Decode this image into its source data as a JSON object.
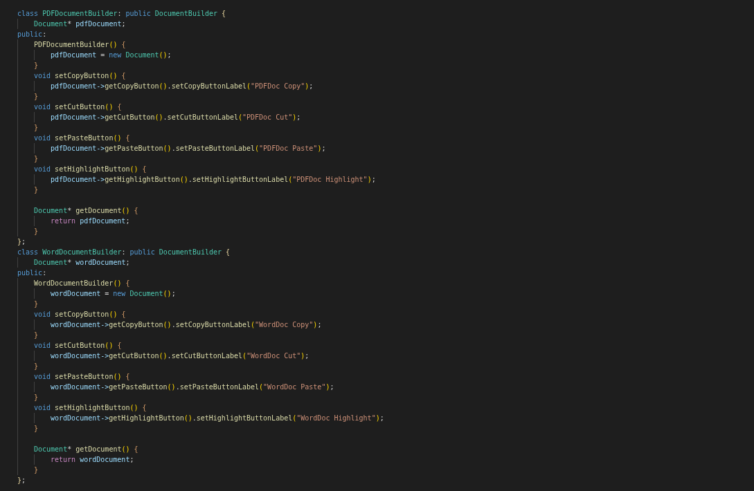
{
  "editor": {
    "lines": [
      {
        "tokens": [
          {
            "kind": "kw",
            "text": "class "
          },
          {
            "kind": "type",
            "text": "PDFDocumentBuilder"
          },
          {
            "kind": "punc",
            "text": ": "
          },
          {
            "kind": "kw",
            "text": "public "
          },
          {
            "kind": "type",
            "text": "DocumentBuilder "
          },
          {
            "kind": "brace",
            "text": "{"
          }
        ],
        "children": [
          {
            "tokens": [
              {
                "kind": "type",
                "text": "Document"
              },
              {
                "kind": "punc",
                "text": "* "
              },
              {
                "kind": "var",
                "text": "pdfDocument"
              },
              {
                "kind": "punc",
                "text": ";"
              }
            ]
          }
        ]
      },
      {
        "tokens": [
          {
            "kind": "kw",
            "text": "public"
          },
          {
            "kind": "punc",
            "text": ":"
          }
        ],
        "groups": [
          [
            {
              "tokens": [
                {
                  "kind": "fn",
                  "text": "PDFDocumentBuilder"
                },
                {
                  "kind": "paren",
                  "text": "()"
                },
                {
                  "kind": "brace2",
                  "text": " {"
                }
              ],
              "children": [
                {
                  "tokens": [
                    {
                      "kind": "var",
                      "text": "pdfDocument"
                    },
                    {
                      "kind": "punc",
                      "text": " = "
                    },
                    {
                      "kind": "kw",
                      "text": "new "
                    },
                    {
                      "kind": "type",
                      "text": "Document"
                    },
                    {
                      "kind": "paren",
                      "text": "()"
                    },
                    {
                      "kind": "punc",
                      "text": ";"
                    }
                  ]
                }
              ]
            },
            {
              "tokens": [
                {
                  "kind": "brace2",
                  "text": "}"
                }
              ]
            },
            {
              "tokens": [
                {
                  "kind": "kw",
                  "text": "void "
                },
                {
                  "kind": "fn",
                  "text": "setCopyButton"
                },
                {
                  "kind": "paren",
                  "text": "()"
                },
                {
                  "kind": "brace2",
                  "text": " {"
                }
              ],
              "children": [
                {
                  "tokens": [
                    {
                      "kind": "var",
                      "text": "pdfDocument->"
                    },
                    {
                      "kind": "fn",
                      "text": "getCopyButton"
                    },
                    {
                      "kind": "paren",
                      "text": "()"
                    },
                    {
                      "kind": "punc",
                      "text": "."
                    },
                    {
                      "kind": "fn",
                      "text": "setCopyButtonLabel"
                    },
                    {
                      "kind": "paren",
                      "text": "("
                    },
                    {
                      "kind": "str",
                      "text": "\"PDFDoc Copy\""
                    },
                    {
                      "kind": "paren",
                      "text": ")"
                    },
                    {
                      "kind": "punc",
                      "text": ";"
                    }
                  ]
                }
              ]
            },
            {
              "tokens": [
                {
                  "kind": "brace2",
                  "text": "}"
                }
              ]
            },
            {
              "tokens": [
                {
                  "kind": "kw",
                  "text": "void "
                },
                {
                  "kind": "fn",
                  "text": "setCutButton"
                },
                {
                  "kind": "paren",
                  "text": "()"
                },
                {
                  "kind": "brace2",
                  "text": " {"
                }
              ],
              "children": [
                {
                  "tokens": [
                    {
                      "kind": "var",
                      "text": "pdfDocument->"
                    },
                    {
                      "kind": "fn",
                      "text": "getCutButton"
                    },
                    {
                      "kind": "paren",
                      "text": "()"
                    },
                    {
                      "kind": "punc",
                      "text": "."
                    },
                    {
                      "kind": "fn",
                      "text": "setCutButtonLabel"
                    },
                    {
                      "kind": "paren",
                      "text": "("
                    },
                    {
                      "kind": "str",
                      "text": "\"PDFDoc Cut\""
                    },
                    {
                      "kind": "paren",
                      "text": ")"
                    },
                    {
                      "kind": "punc",
                      "text": ";"
                    }
                  ]
                }
              ]
            },
            {
              "tokens": [
                {
                  "kind": "brace2",
                  "text": "}"
                }
              ]
            },
            {
              "tokens": [
                {
                  "kind": "kw",
                  "text": "void "
                },
                {
                  "kind": "fn",
                  "text": "setPasteButton"
                },
                {
                  "kind": "paren",
                  "text": "()"
                },
                {
                  "kind": "brace2",
                  "text": " {"
                }
              ],
              "children": [
                {
                  "tokens": [
                    {
                      "kind": "var",
                      "text": "pdfDocument->"
                    },
                    {
                      "kind": "fn",
                      "text": "getPasteButton"
                    },
                    {
                      "kind": "paren",
                      "text": "()"
                    },
                    {
                      "kind": "punc",
                      "text": "."
                    },
                    {
                      "kind": "fn",
                      "text": "setPasteButtonLabel"
                    },
                    {
                      "kind": "paren",
                      "text": "("
                    },
                    {
                      "kind": "str",
                      "text": "\"PDFDoc Paste\""
                    },
                    {
                      "kind": "paren",
                      "text": ")"
                    },
                    {
                      "kind": "punc",
                      "text": ";"
                    }
                  ]
                }
              ]
            },
            {
              "tokens": [
                {
                  "kind": "brace2",
                  "text": "}"
                }
              ]
            },
            {
              "tokens": [
                {
                  "kind": "kw",
                  "text": "void "
                },
                {
                  "kind": "fn",
                  "text": "setHighlightButton"
                },
                {
                  "kind": "paren",
                  "text": "()"
                },
                {
                  "kind": "brace2",
                  "text": " {"
                }
              ],
              "children": [
                {
                  "tokens": [
                    {
                      "kind": "var",
                      "text": "pdfDocument->"
                    },
                    {
                      "kind": "fn",
                      "text": "getHighlightButton"
                    },
                    {
                      "kind": "paren",
                      "text": "()"
                    },
                    {
                      "kind": "punc",
                      "text": "."
                    },
                    {
                      "kind": "fn",
                      "text": "setHighlightButtonLabel"
                    },
                    {
                      "kind": "paren",
                      "text": "("
                    },
                    {
                      "kind": "str",
                      "text": "\"PDFDoc Highlight\""
                    },
                    {
                      "kind": "paren",
                      "text": ")"
                    },
                    {
                      "kind": "punc",
                      "text": ";"
                    }
                  ]
                }
              ]
            },
            {
              "tokens": [
                {
                  "kind": "brace2",
                  "text": "}"
                }
              ]
            }
          ],
          [
            {
              "tokens": [
                {
                  "kind": "type",
                  "text": "Document"
                },
                {
                  "kind": "punc",
                  "text": "* "
                },
                {
                  "kind": "fn",
                  "text": "getDocument"
                },
                {
                  "kind": "paren",
                  "text": "()"
                },
                {
                  "kind": "brace2",
                  "text": " {"
                }
              ],
              "children": [
                {
                  "tokens": [
                    {
                      "kind": "ctrl",
                      "text": "return "
                    },
                    {
                      "kind": "var",
                      "text": "pdfDocument"
                    },
                    {
                      "kind": "punc",
                      "text": ";"
                    }
                  ]
                }
              ]
            },
            {
              "tokens": [
                {
                  "kind": "brace2",
                  "text": "}"
                }
              ]
            }
          ]
        ]
      },
      {
        "tokens": [
          {
            "kind": "brace",
            "text": "}"
          },
          {
            "kind": "punc",
            "text": ";"
          }
        ]
      },
      {
        "tokens": [
          {
            "kind": "kw",
            "text": "class "
          },
          {
            "kind": "type",
            "text": "WordDocumentBuilder"
          },
          {
            "kind": "punc",
            "text": ": "
          },
          {
            "kind": "kw",
            "text": "public "
          },
          {
            "kind": "type",
            "text": "DocumentBuilder "
          },
          {
            "kind": "brace",
            "text": "{"
          }
        ],
        "children": [
          {
            "tokens": [
              {
                "kind": "type",
                "text": "Document"
              },
              {
                "kind": "punc",
                "text": "* "
              },
              {
                "kind": "var",
                "text": "wordDocument"
              },
              {
                "kind": "punc",
                "text": ";"
              }
            ]
          }
        ]
      },
      {
        "tokens": [
          {
            "kind": "kw",
            "text": "public"
          },
          {
            "kind": "punc",
            "text": ":"
          }
        ],
        "groups": [
          [
            {
              "tokens": [
                {
                  "kind": "fn",
                  "text": "WordDocumentBuilder"
                },
                {
                  "kind": "paren",
                  "text": "()"
                },
                {
                  "kind": "brace2",
                  "text": " {"
                }
              ],
              "children": [
                {
                  "tokens": [
                    {
                      "kind": "var",
                      "text": "wordDocument"
                    },
                    {
                      "kind": "punc",
                      "text": " = "
                    },
                    {
                      "kind": "kw",
                      "text": "new "
                    },
                    {
                      "kind": "type",
                      "text": "Document"
                    },
                    {
                      "kind": "paren",
                      "text": "()"
                    },
                    {
                      "kind": "punc",
                      "text": ";"
                    }
                  ]
                }
              ]
            },
            {
              "tokens": [
                {
                  "kind": "brace2",
                  "text": "}"
                }
              ]
            },
            {
              "tokens": [
                {
                  "kind": "kw",
                  "text": "void "
                },
                {
                  "kind": "fn",
                  "text": "setCopyButton"
                },
                {
                  "kind": "paren",
                  "text": "()"
                },
                {
                  "kind": "brace2",
                  "text": " {"
                }
              ],
              "children": [
                {
                  "tokens": [
                    {
                      "kind": "var",
                      "text": "wordDocument->"
                    },
                    {
                      "kind": "fn",
                      "text": "getCopyButton"
                    },
                    {
                      "kind": "paren",
                      "text": "()"
                    },
                    {
                      "kind": "punc",
                      "text": "."
                    },
                    {
                      "kind": "fn",
                      "text": "setCopyButtonLabel"
                    },
                    {
                      "kind": "paren",
                      "text": "("
                    },
                    {
                      "kind": "str",
                      "text": "\"WordDoc Copy\""
                    },
                    {
                      "kind": "paren",
                      "text": ")"
                    },
                    {
                      "kind": "punc",
                      "text": ";"
                    }
                  ]
                }
              ]
            },
            {
              "tokens": [
                {
                  "kind": "brace2",
                  "text": "}"
                }
              ]
            },
            {
              "tokens": [
                {
                  "kind": "kw",
                  "text": "void "
                },
                {
                  "kind": "fn",
                  "text": "setCutButton"
                },
                {
                  "kind": "paren",
                  "text": "()"
                },
                {
                  "kind": "brace2",
                  "text": " {"
                }
              ],
              "children": [
                {
                  "tokens": [
                    {
                      "kind": "var",
                      "text": "wordDocument->"
                    },
                    {
                      "kind": "fn",
                      "text": "getCutButton"
                    },
                    {
                      "kind": "paren",
                      "text": "()"
                    },
                    {
                      "kind": "punc",
                      "text": "."
                    },
                    {
                      "kind": "fn",
                      "text": "setCutButtonLabel"
                    },
                    {
                      "kind": "paren",
                      "text": "("
                    },
                    {
                      "kind": "str",
                      "text": "\"WordDoc Cut\""
                    },
                    {
                      "kind": "paren",
                      "text": ")"
                    },
                    {
                      "kind": "punc",
                      "text": ";"
                    }
                  ]
                }
              ]
            },
            {
              "tokens": [
                {
                  "kind": "brace2",
                  "text": "}"
                }
              ]
            },
            {
              "tokens": [
                {
                  "kind": "kw",
                  "text": "void "
                },
                {
                  "kind": "fn",
                  "text": "setPasteButton"
                },
                {
                  "kind": "paren",
                  "text": "()"
                },
                {
                  "kind": "brace2",
                  "text": " {"
                }
              ],
              "children": [
                {
                  "tokens": [
                    {
                      "kind": "var",
                      "text": "wordDocument->"
                    },
                    {
                      "kind": "fn",
                      "text": "getPasteButton"
                    },
                    {
                      "kind": "paren",
                      "text": "()"
                    },
                    {
                      "kind": "punc",
                      "text": "."
                    },
                    {
                      "kind": "fn",
                      "text": "setPasteButtonLabel"
                    },
                    {
                      "kind": "paren",
                      "text": "("
                    },
                    {
                      "kind": "str",
                      "text": "\"WordDoc Paste\""
                    },
                    {
                      "kind": "paren",
                      "text": ")"
                    },
                    {
                      "kind": "punc",
                      "text": ";"
                    }
                  ]
                }
              ]
            },
            {
              "tokens": [
                {
                  "kind": "brace2",
                  "text": "}"
                }
              ]
            },
            {
              "tokens": [
                {
                  "kind": "kw",
                  "text": "void "
                },
                {
                  "kind": "fn",
                  "text": "setHighlightButton"
                },
                {
                  "kind": "paren",
                  "text": "()"
                },
                {
                  "kind": "brace2",
                  "text": " {"
                }
              ],
              "children": [
                {
                  "tokens": [
                    {
                      "kind": "var",
                      "text": "wordDocument->"
                    },
                    {
                      "kind": "fn",
                      "text": "getHighlightButton"
                    },
                    {
                      "kind": "paren",
                      "text": "()"
                    },
                    {
                      "kind": "punc",
                      "text": "."
                    },
                    {
                      "kind": "fn",
                      "text": "setHighlightButtonLabel"
                    },
                    {
                      "kind": "paren",
                      "text": "("
                    },
                    {
                      "kind": "str",
                      "text": "\"WordDoc Highlight\""
                    },
                    {
                      "kind": "paren",
                      "text": ")"
                    },
                    {
                      "kind": "punc",
                      "text": ";"
                    }
                  ]
                }
              ]
            },
            {
              "tokens": [
                {
                  "kind": "brace2",
                  "text": "}"
                }
              ]
            }
          ],
          [
            {
              "tokens": [
                {
                  "kind": "type",
                  "text": "Document"
                },
                {
                  "kind": "punc",
                  "text": "* "
                },
                {
                  "kind": "fn",
                  "text": "getDocument"
                },
                {
                  "kind": "paren",
                  "text": "()"
                },
                {
                  "kind": "brace2",
                  "text": " {"
                }
              ],
              "children": [
                {
                  "tokens": [
                    {
                      "kind": "ctrl",
                      "text": "return "
                    },
                    {
                      "kind": "var",
                      "text": "wordDocument"
                    },
                    {
                      "kind": "punc",
                      "text": ";"
                    }
                  ]
                }
              ]
            },
            {
              "tokens": [
                {
                  "kind": "brace2",
                  "text": "}"
                }
              ]
            }
          ]
        ]
      },
      {
        "tokens": [
          {
            "kind": "brace",
            "text": "}"
          },
          {
            "kind": "punc",
            "text": ";"
          }
        ]
      }
    ]
  }
}
